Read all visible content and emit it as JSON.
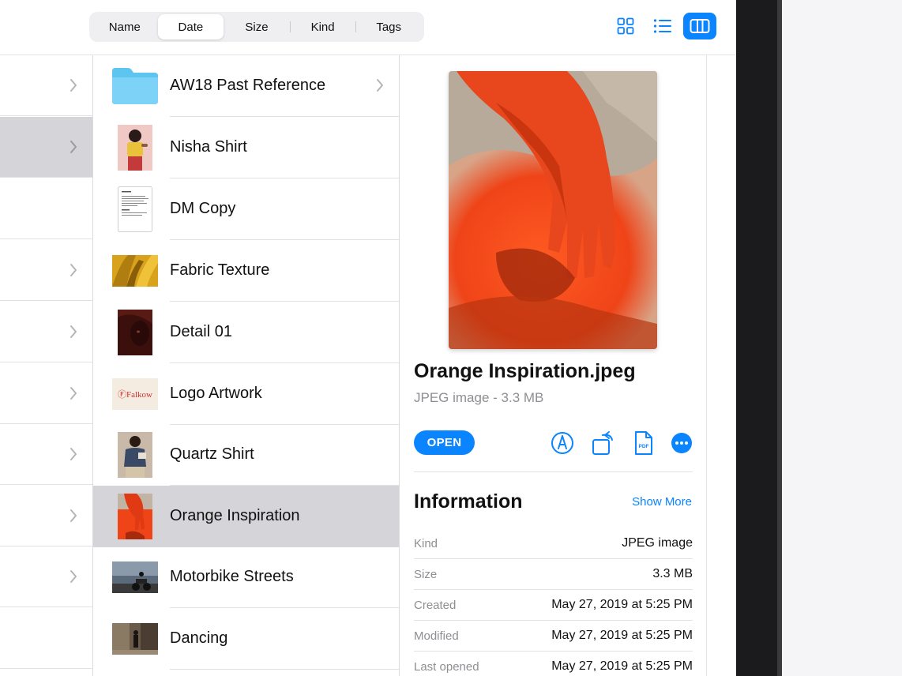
{
  "toolbar": {
    "sort_tabs": [
      {
        "label": "Name",
        "active": false
      },
      {
        "label": "Date",
        "active": true
      },
      {
        "label": "Size",
        "active": false
      },
      {
        "label": "Kind",
        "active": false
      },
      {
        "label": "Tags",
        "active": false
      }
    ],
    "view_buttons": [
      {
        "icon": "grid-view-icon",
        "active": false
      },
      {
        "icon": "list-view-icon",
        "active": false
      },
      {
        "icon": "column-view-icon",
        "active": true
      }
    ]
  },
  "sidebar": {
    "rows": [
      {
        "has_chevron": true,
        "selected": false
      },
      {
        "has_chevron": true,
        "selected": true
      },
      {
        "has_chevron": false,
        "selected": false
      },
      {
        "has_chevron": true,
        "selected": false
      },
      {
        "has_chevron": true,
        "selected": false
      },
      {
        "has_chevron": true,
        "selected": false
      },
      {
        "has_chevron": true,
        "selected": false
      },
      {
        "has_chevron": true,
        "selected": false
      },
      {
        "has_chevron": true,
        "selected": false
      },
      {
        "has_chevron": false,
        "selected": false
      }
    ]
  },
  "files": [
    {
      "name": "AW18 Past Reference",
      "kind": "folder",
      "has_chevron": true,
      "selected": false
    },
    {
      "name": "Nisha Shirt",
      "kind": "image",
      "has_chevron": false,
      "selected": false
    },
    {
      "name": "DM Copy",
      "kind": "document",
      "has_chevron": false,
      "selected": false
    },
    {
      "name": "Fabric Texture",
      "kind": "image",
      "has_chevron": false,
      "selected": false
    },
    {
      "name": "Detail 01",
      "kind": "image",
      "has_chevron": false,
      "selected": false
    },
    {
      "name": "Logo Artwork",
      "kind": "image",
      "logo_text": "ⒻFalkow",
      "has_chevron": false,
      "selected": false
    },
    {
      "name": "Quartz Shirt",
      "kind": "image",
      "has_chevron": false,
      "selected": false
    },
    {
      "name": "Orange Inspiration",
      "kind": "image",
      "has_chevron": false,
      "selected": true
    },
    {
      "name": "Motorbike Streets",
      "kind": "image",
      "has_chevron": false,
      "selected": false
    },
    {
      "name": "Dancing",
      "kind": "image",
      "has_chevron": false,
      "selected": false
    }
  ],
  "preview": {
    "file_name": "Orange Inspiration.jpeg",
    "subtitle": "JPEG image - 3.3 MB",
    "open_label": "OPEN",
    "actions": [
      "markup-icon",
      "rotate-icon",
      "create-pdf-icon",
      "more-icon"
    ],
    "info_title": "Information",
    "show_more": "Show More",
    "info": [
      {
        "key": "Kind",
        "value": "JPEG image"
      },
      {
        "key": "Size",
        "value": "3.3 MB"
      },
      {
        "key": "Created",
        "value": "May 27, 2019 at 5:25 PM"
      },
      {
        "key": "Modified",
        "value": "May 27, 2019 at 5:25 PM"
      },
      {
        "key": "Last opened",
        "value": "May 27, 2019 at 5:25 PM"
      }
    ]
  },
  "colors": {
    "accent": "#0a84ff",
    "selection": "#d4d4d9",
    "folder": "#5ec4f0",
    "orange_dust": "#f24a1e",
    "bezel": "#1b1b1d"
  }
}
